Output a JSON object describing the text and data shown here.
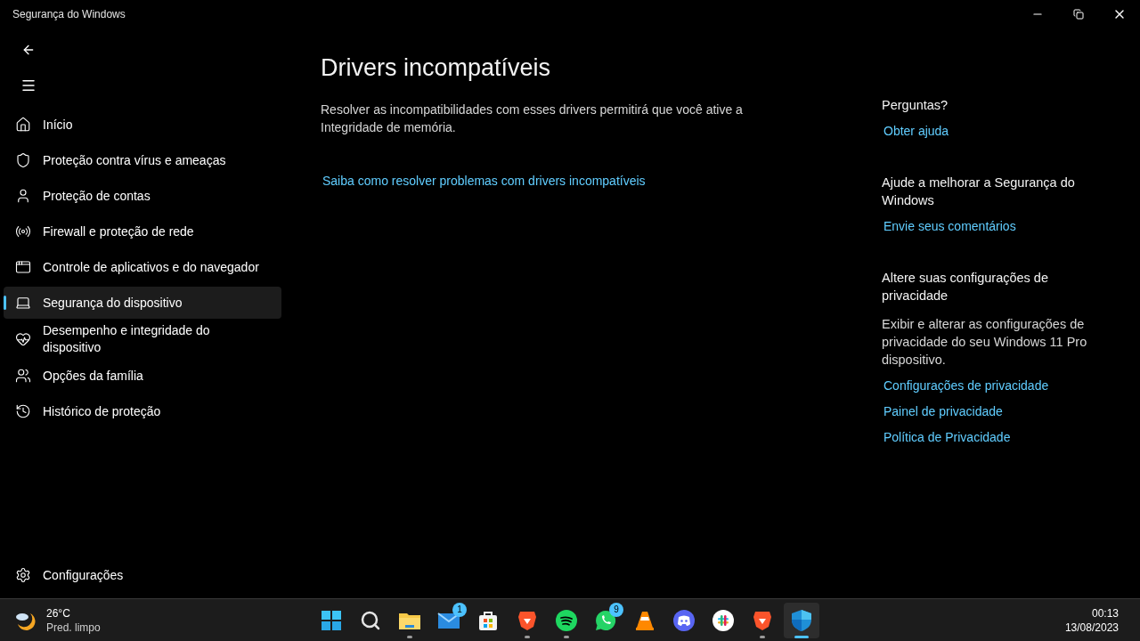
{
  "window": {
    "title": "Segurança do Windows"
  },
  "sidebar": {
    "items": [
      {
        "label": "Início",
        "kind": "home",
        "selected": false
      },
      {
        "label": "Proteção contra vírus e ameaças",
        "kind": "shield",
        "selected": false
      },
      {
        "label": "Proteção de contas",
        "kind": "user",
        "selected": false
      },
      {
        "label": "Firewall e proteção de rede",
        "kind": "antenna",
        "selected": false
      },
      {
        "label": "Controle de aplicativos e do navegador",
        "kind": "window",
        "selected": false
      },
      {
        "label": "Segurança do dispositivo",
        "kind": "laptop",
        "selected": true
      },
      {
        "label": "Desempenho e integridade do dispositivo",
        "kind": "heart",
        "selected": false
      },
      {
        "label": "Opções da família",
        "kind": "family",
        "selected": false
      },
      {
        "label": "Histórico de proteção",
        "kind": "history",
        "selected": false
      }
    ],
    "settings": "Configurações"
  },
  "main": {
    "heading": "Drivers incompatíveis",
    "description": "Resolver as incompatibilidades com esses drivers permitirá que você ative a Integridade de memória.",
    "link": "Saiba como resolver problemas com drivers incompatíveis"
  },
  "aside": {
    "sections": [
      {
        "heading": "Perguntas?",
        "links": [
          "Obter ajuda"
        ]
      },
      {
        "heading": "Ajude a melhorar a Segurança do Windows",
        "links": [
          "Envie seus comentários"
        ]
      },
      {
        "heading": "Altere suas configurações de privacidade",
        "text": "Exibir e alterar as configurações de privacidade do seu Windows 11 Pro dispositivo.",
        "links": [
          "Configurações de privacidade",
          "Painel de privacidade",
          "Política de Privacidade"
        ]
      }
    ]
  },
  "taskbar": {
    "weather": {
      "temperature": "26°C",
      "condition": "Pred. limpo"
    },
    "apps": [
      {
        "kind": "start",
        "running": false,
        "active": false
      },
      {
        "kind": "search",
        "running": false,
        "active": false
      },
      {
        "kind": "folder",
        "running": true,
        "active": false
      },
      {
        "kind": "mail",
        "running": false,
        "active": false,
        "badge": "1"
      },
      {
        "kind": "store",
        "running": false,
        "active": false
      },
      {
        "kind": "lion",
        "running": true,
        "active": false
      },
      {
        "kind": "music",
        "running": true,
        "active": false
      },
      {
        "kind": "chat",
        "running": false,
        "active": false,
        "badge": "9"
      },
      {
        "kind": "cone",
        "running": false,
        "active": false
      },
      {
        "kind": "gamepad",
        "running": false,
        "active": false
      },
      {
        "kind": "hash",
        "running": false,
        "active": false
      },
      {
        "kind": "lion",
        "running": true,
        "active": false
      },
      {
        "kind": "shield",
        "running": true,
        "active": true
      }
    ],
    "time": "00:13",
    "date": "13/08/2023"
  }
}
